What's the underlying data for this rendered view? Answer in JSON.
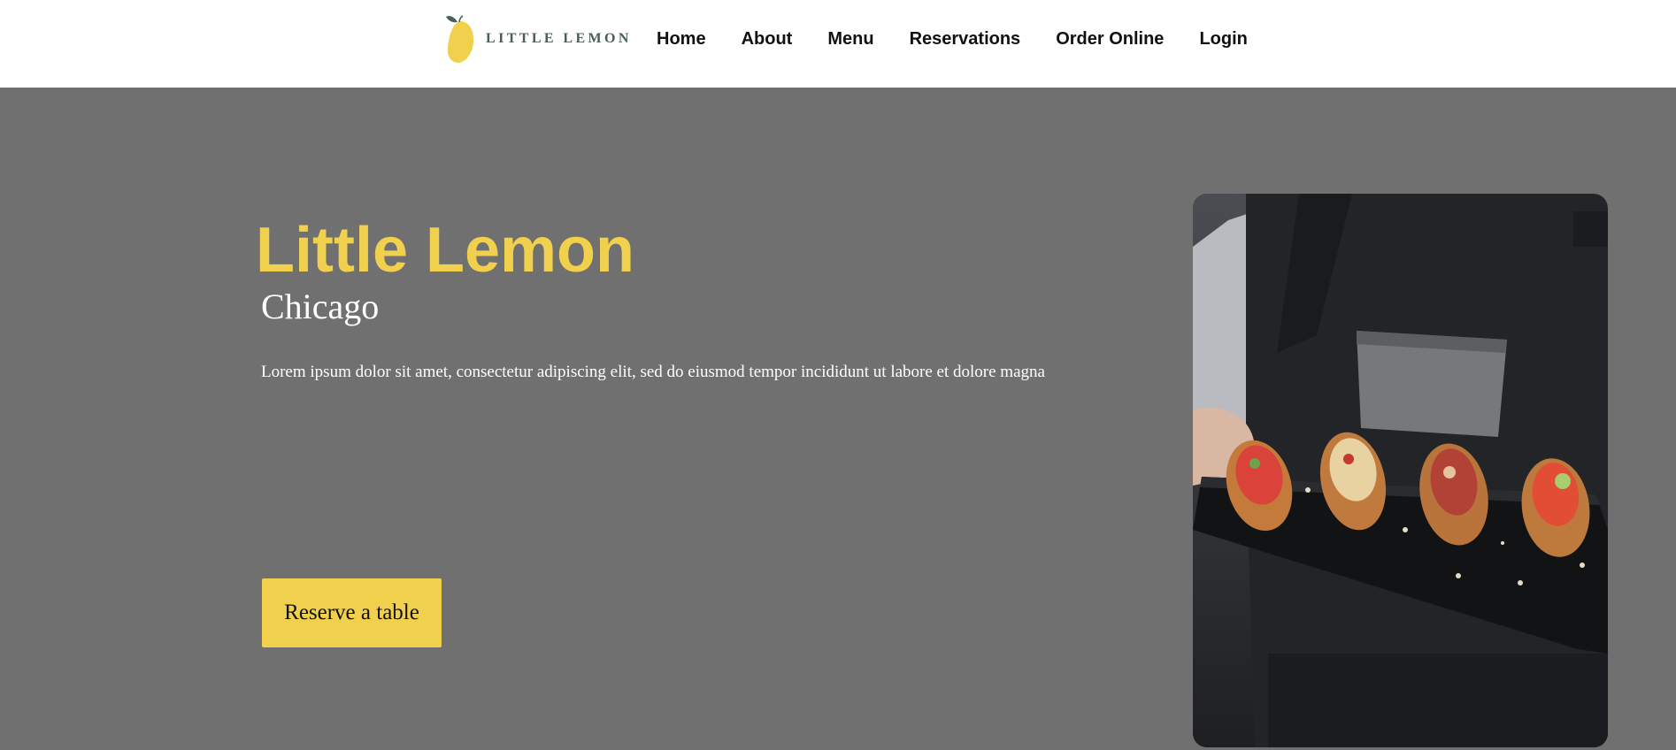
{
  "header": {
    "logo_text": "LITTLE LEMON",
    "logo_icon": "lemon-icon",
    "nav": [
      {
        "label": "Home"
      },
      {
        "label": "About"
      },
      {
        "label": "Menu"
      },
      {
        "label": "Reservations"
      },
      {
        "label": "Order Online"
      },
      {
        "label": "Login"
      }
    ]
  },
  "hero": {
    "title": "Little Lemon",
    "subtitle": "Chicago",
    "description": "Lorem ipsum dolor sit amet, consectetur adipiscing elit, sed do eiusmod tempor incididunt ut labore et dolore magna",
    "button_label": "Reserve a table",
    "image_alt": ""
  },
  "colors": {
    "primary_yellow": "#f0d04c",
    "hero_background": "#707070",
    "logo_green": "#495e57",
    "nav_text": "#111111"
  }
}
